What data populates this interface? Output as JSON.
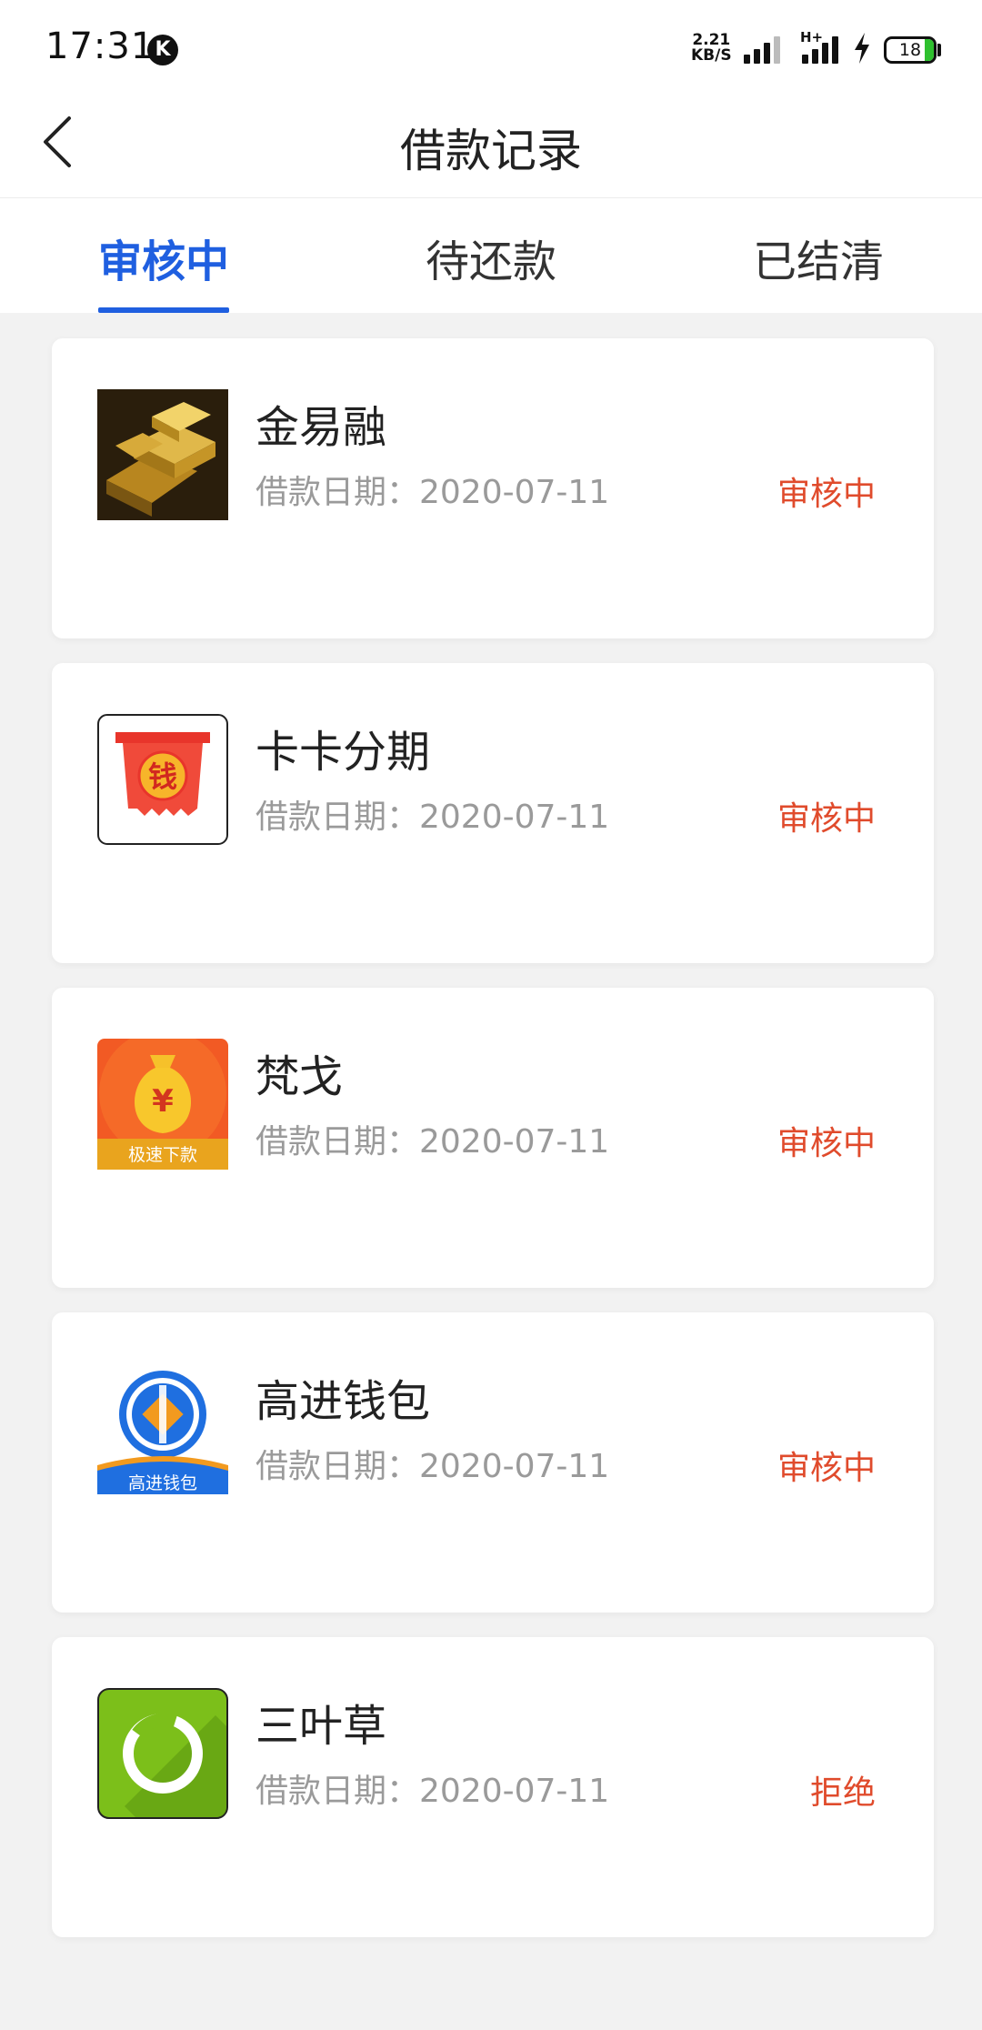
{
  "status_bar": {
    "time": "17:31",
    "badge": "K",
    "speed_value": "2.21",
    "speed_unit": "KB/S",
    "network": "H+",
    "battery": "18"
  },
  "header": {
    "title": "借款记录"
  },
  "tabs": [
    {
      "label": "审核中",
      "active": true
    },
    {
      "label": "待还款",
      "active": false
    },
    {
      "label": "已结清",
      "active": false
    }
  ],
  "loans": [
    {
      "name": "金易融",
      "date": "借款日期：2020-07-11",
      "status": "审核中",
      "logo": "gold-bars-logo"
    },
    {
      "name": "卡卡分期",
      "date": "借款日期：2020-07-11",
      "status": "审核中",
      "logo": "red-money-scroll-logo",
      "logo_text": "钱"
    },
    {
      "name": "梵戈",
      "date": "借款日期：2020-07-11",
      "status": "审核中",
      "logo": "money-bag-logo",
      "logo_text": "极速下款",
      "logo_symbol": "¥"
    },
    {
      "name": "高进钱包",
      "date": "借款日期：2020-07-11",
      "status": "审核中",
      "logo": "blue-coin-logo",
      "logo_text": "高进钱包"
    },
    {
      "name": "三叶草",
      "date": "借款日期：2020-07-11",
      "status": "拒绝",
      "logo": "green-ring-logo"
    }
  ],
  "colors": {
    "accent": "#1f5fe0",
    "status": "#e04b2c",
    "background": "#f2f2f2"
  }
}
